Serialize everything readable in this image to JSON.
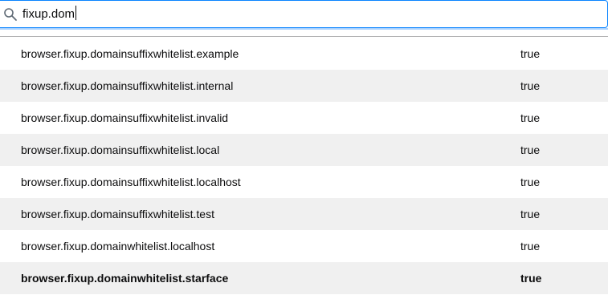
{
  "search": {
    "value": "fixup.dom",
    "icon": "search-icon"
  },
  "colors": {
    "accent": "#0a84ff",
    "focus_ring": "#a8d1ff",
    "row_alt": "#f0f0f0",
    "text": "#0c0c0d"
  },
  "preferences": [
    {
      "name": "browser.fixup.domainsuffixwhitelist.example",
      "value": "true",
      "modified": false
    },
    {
      "name": "browser.fixup.domainsuffixwhitelist.internal",
      "value": "true",
      "modified": false
    },
    {
      "name": "browser.fixup.domainsuffixwhitelist.invalid",
      "value": "true",
      "modified": false
    },
    {
      "name": "browser.fixup.domainsuffixwhitelist.local",
      "value": "true",
      "modified": false
    },
    {
      "name": "browser.fixup.domainsuffixwhitelist.localhost",
      "value": "true",
      "modified": false
    },
    {
      "name": "browser.fixup.domainsuffixwhitelist.test",
      "value": "true",
      "modified": false
    },
    {
      "name": "browser.fixup.domainwhitelist.localhost",
      "value": "true",
      "modified": false
    },
    {
      "name": "browser.fixup.domainwhitelist.starface",
      "value": "true",
      "modified": true
    }
  ]
}
